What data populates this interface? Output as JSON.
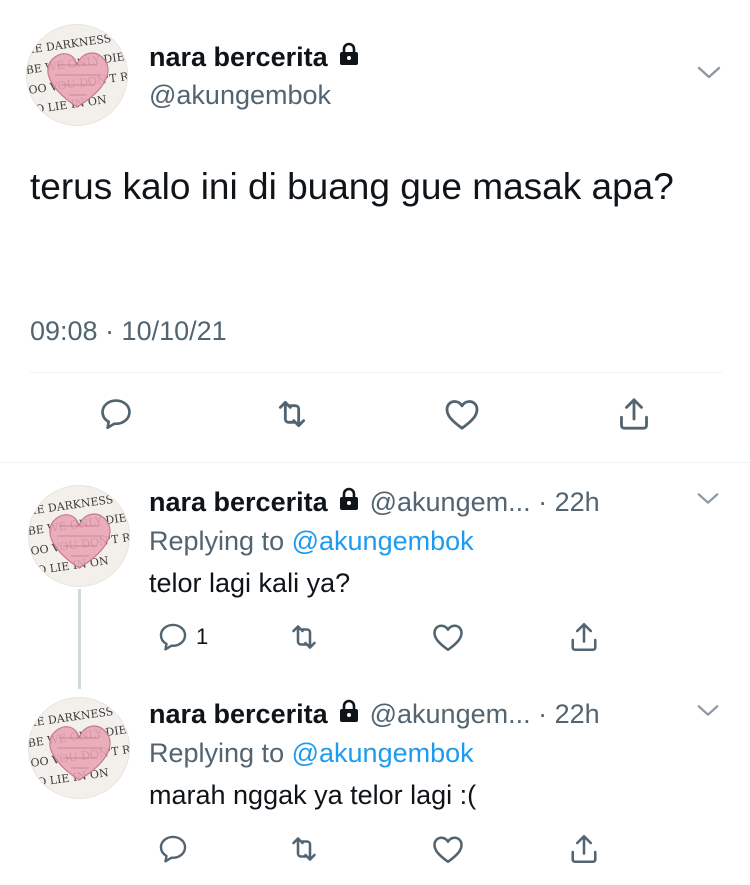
{
  "main_tweet": {
    "display_name": "nara bercerita",
    "handle": "@akungembok",
    "text": "terus kalo ini di buang gue masak apa?",
    "timestamp": "09:08 · 10/10/21",
    "lock_icon": "lock-icon",
    "actions": [
      "reply-icon",
      "retweet-icon",
      "like-icon",
      "share-icon"
    ]
  },
  "replies": [
    {
      "display_name": "nara bercerita",
      "handle_time": "@akungem... · 22h",
      "replying_prefix": "Replying to",
      "replying_to": "@akungembok",
      "text": "telor lagi kali ya?",
      "reply_count": "1"
    },
    {
      "display_name": "nara bercerita",
      "handle_time": "@akungem... · 22h",
      "replying_prefix": "Replying to",
      "replying_to": "@akungembok",
      "text": "marah nggak ya telor lagi :("
    }
  ],
  "colors": {
    "text": "#0f1419",
    "secondary": "#536471",
    "link": "#1d9bf0",
    "avatar_heart": "#e8a3b3"
  }
}
